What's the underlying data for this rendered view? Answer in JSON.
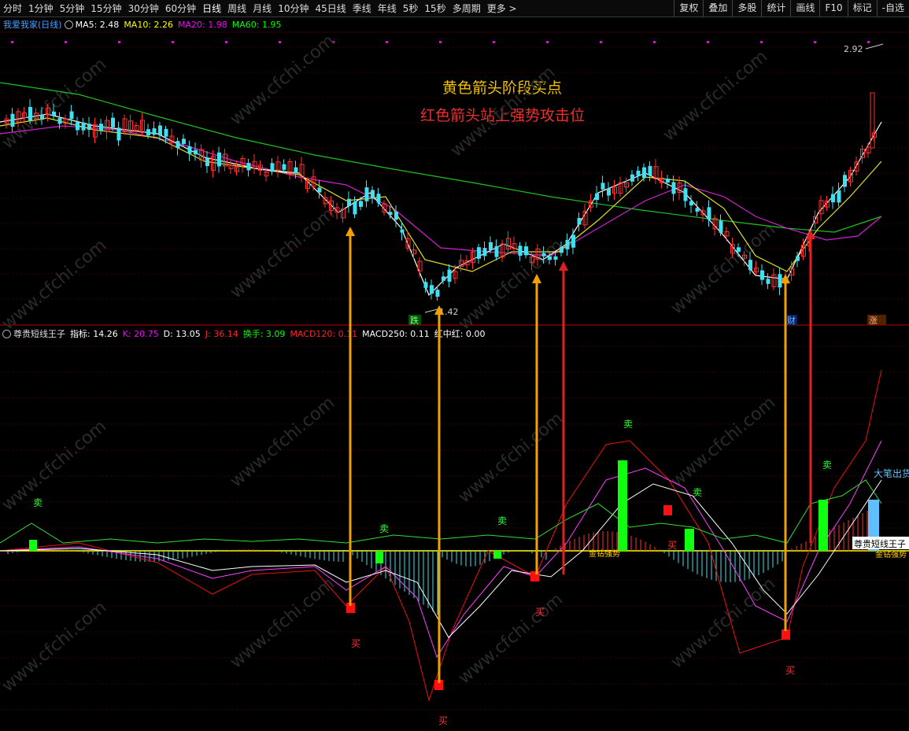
{
  "toolbar": {
    "periods": [
      "分时",
      "1分钟",
      "5分钟",
      "15分钟",
      "30分钟",
      "60分钟",
      "日线",
      "周线",
      "月线",
      "10分钟",
      "45日线",
      "季线",
      "年线",
      "5秒",
      "15秒",
      "多周期",
      "更多 >"
    ],
    "active": "日线",
    "right_tools": [
      "复权",
      "叠加",
      "多股",
      "统计",
      "画线",
      "F10",
      "标记",
      "-自选"
    ]
  },
  "main_chart": {
    "title": "我爱我家(日线)",
    "ma": [
      {
        "label": "MA5:",
        "value": "2.48",
        "color": "#ffffff"
      },
      {
        "label": "MA10:",
        "value": "2.26",
        "color": "#ffff00"
      },
      {
        "label": "MA20:",
        "value": "1.98",
        "color": "#ff00ff"
      },
      {
        "label": "MA60:",
        "value": "1.95",
        "color": "#00ff00"
      }
    ],
    "high_marker": "2.92",
    "low_marker": "1.42",
    "tags": {
      "die": "跌",
      "cai": "财",
      "zhang": "涨"
    }
  },
  "annotations": {
    "line1": "黄色箭头阶段买点",
    "line2": "红色箭头站上强势攻击位"
  },
  "indicator": {
    "name": "尊贵短线王子",
    "fields": [
      {
        "label": "指标:",
        "value": "14.26",
        "color": "#ffffff"
      },
      {
        "label": "K:",
        "value": "20.75",
        "color": "#ff00ff"
      },
      {
        "label": "D:",
        "value": "13.05",
        "color": "#ffffff"
      },
      {
        "label": "J:",
        "value": "36.14",
        "color": "#ff2020"
      },
      {
        "label": "换手:",
        "value": "3.09",
        "color": "#00ff00"
      },
      {
        "label": "MACD120:",
        "value": "0.11",
        "color": "#ff2020"
      },
      {
        "label": "MACD250:",
        "value": "0.11",
        "color": "#ffffff"
      },
      {
        "label": "红中红:",
        "value": "0.00",
        "color": "#ffffff"
      }
    ],
    "buy_label": "买",
    "sell_label": "卖",
    "big_sell": "大笔出货",
    "gold_text": "金钻强势",
    "tail_label": "尊贵短线王子"
  },
  "watermark": "www.cfchi.com"
}
